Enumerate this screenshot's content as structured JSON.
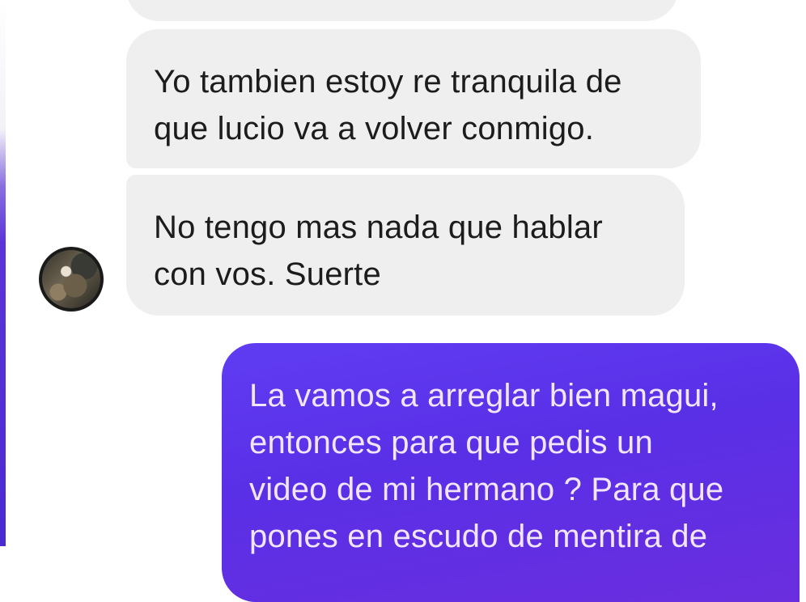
{
  "conversation": {
    "messages": [
      {
        "direction": "received",
        "text": "Yo tambien estoy re tranquila de\nque lucio va a volver conmigo."
      },
      {
        "direction": "received",
        "text": "No tengo mas nada que hablar\ncon vos. Suerte"
      },
      {
        "direction": "sent",
        "text": "La vamos a arreglar bien magui,\nentonces para que pedis un\nvideo de mi hermano ? Para que\npones en escudo de mentira de"
      }
    ]
  },
  "colors": {
    "received_bubble": "#efeff0",
    "sent_bubble": "#5a2fe6",
    "sent_text": "#f2e6ff"
  },
  "icons": {
    "contact_avatar": "contact-avatar-photo"
  }
}
